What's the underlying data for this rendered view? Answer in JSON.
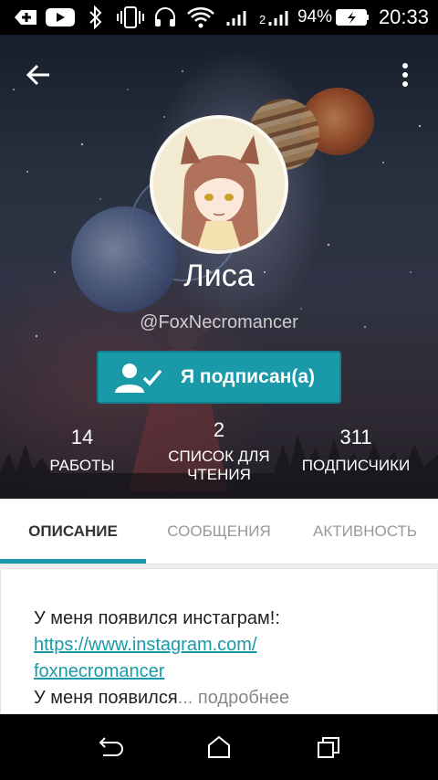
{
  "status_bar": {
    "battery_percent": "94%",
    "time": "20:33",
    "icons": [
      "add-icon",
      "youtube-icon",
      "bluetooth-icon",
      "vibrate-icon",
      "headset-icon",
      "wifi-icon",
      "signal-icon",
      "signal-2-icon",
      "battery-charging-icon"
    ]
  },
  "header": {
    "back_icon": "arrow-back-icon",
    "menu_icon": "more-vertical-icon"
  },
  "profile": {
    "name": "Лиса",
    "handle": "@FoxNecromancer",
    "follow_label": "Я подписан(а)",
    "follow_icon": "person-check-icon"
  },
  "stats": [
    {
      "value": "14",
      "label": "РАБОТЫ"
    },
    {
      "value": "2",
      "label": "СПИСОК ДЛЯ ЧТЕНИЯ"
    },
    {
      "value": "311",
      "label": "ПОДПИСЧИКИ"
    }
  ],
  "tabs": [
    {
      "label": "ОПИСАНИЕ",
      "active": true
    },
    {
      "label": "СООБЩЕНИЯ",
      "active": false
    },
    {
      "label": "АКТИВНОСТЬ",
      "active": false
    }
  ],
  "description": {
    "line1": "У меня появился инстаграм!:",
    "link_line1": "https://www.instagram.com/",
    "link_line2": "foxnecromancer",
    "line3_text": "У меня появился",
    "ellipsis": "...",
    "more": " подробнее"
  },
  "nav": [
    "back-nav-icon",
    "home-nav-icon",
    "recents-nav-icon"
  ],
  "colors": {
    "accent": "#1a9aa9",
    "status_bar": "#000000"
  }
}
